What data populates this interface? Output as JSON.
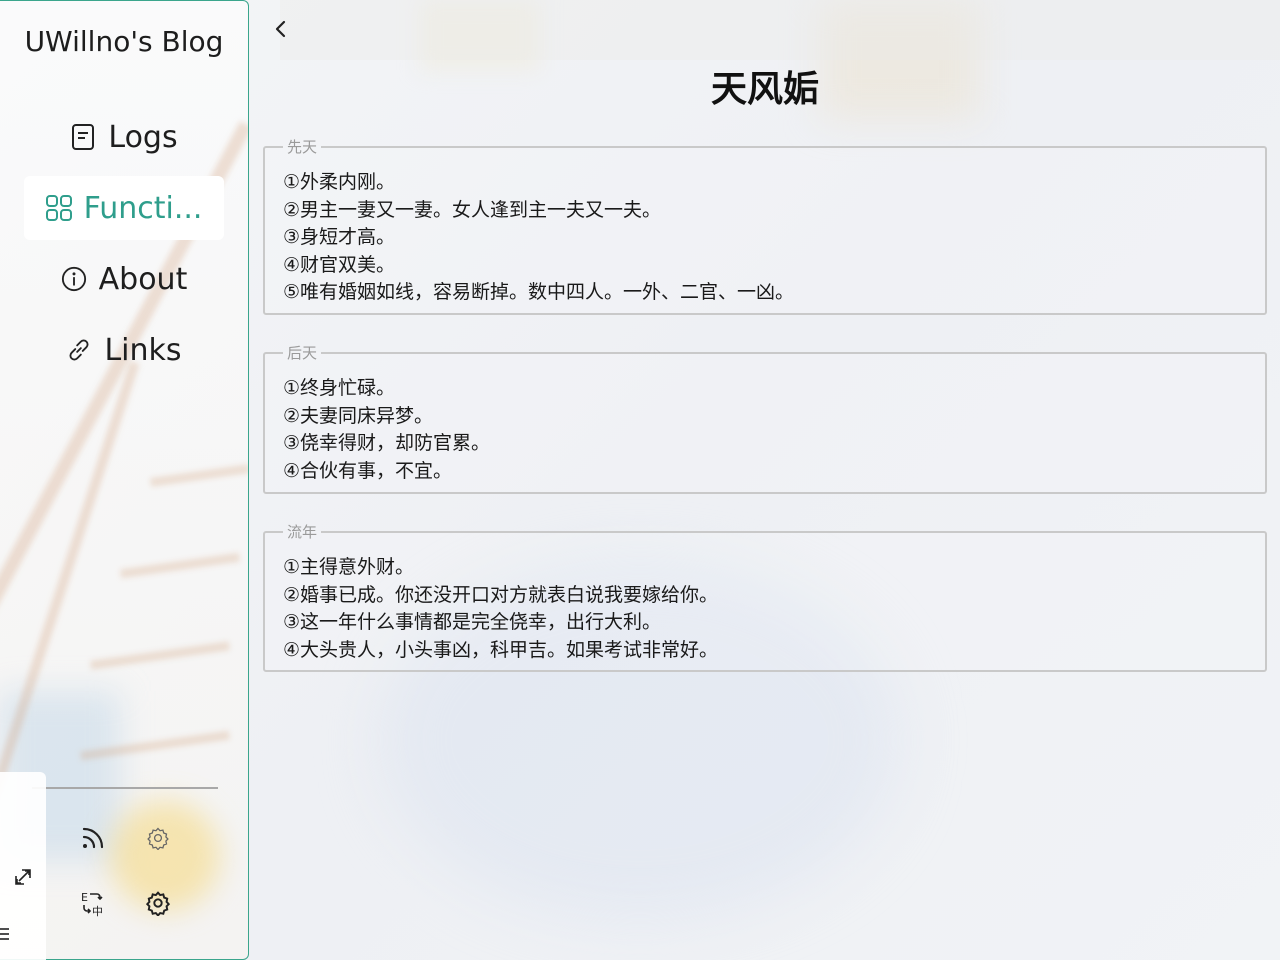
{
  "sidebar": {
    "brand": "UWillno's Blog",
    "nav": [
      {
        "label": "Logs",
        "icon": "document-icon"
      },
      {
        "label": "Functi...",
        "icon": "grid-icon",
        "active": true
      },
      {
        "label": "About",
        "icon": "info-icon"
      },
      {
        "label": "Links",
        "icon": "link-icon"
      }
    ],
    "tools": [
      "rss-icon",
      "gear-icon",
      "translate-icon",
      "settings-icon"
    ],
    "mini_panel": [
      "expand-icon",
      "menu-icon"
    ]
  },
  "main": {
    "title": "天风姤",
    "sections": [
      {
        "legend": "先天",
        "lines": [
          "①外柔内刚。",
          "②男主一妻又一妻。女人逢到主一夫又一夫。",
          "③身短才高。",
          "④财官双美。",
          "⑤唯有婚姻如线，容易断掉。数中四人。一外、二官、一凶。"
        ]
      },
      {
        "legend": "后天",
        "lines": [
          "①终身忙碌。",
          "②夫妻同床异梦。",
          "③侥幸得财，却防官累。",
          "④合伙有事，不宜。"
        ]
      },
      {
        "legend": "流年",
        "lines": [
          "①主得意外财。",
          "②婚事已成。你还没开口对方就表白说我要嫁给你。",
          "③这一年什么事情都是完全侥幸，出行大利。",
          "④大头贵人，小头事凶，科甲吉。如果考试非常好。"
        ]
      }
    ]
  },
  "colors": {
    "accent": "#2f9e8c",
    "sidebar_border": "#3aa58c",
    "card_border": "#c9c9c9",
    "legend_text": "#9a9a9a"
  }
}
